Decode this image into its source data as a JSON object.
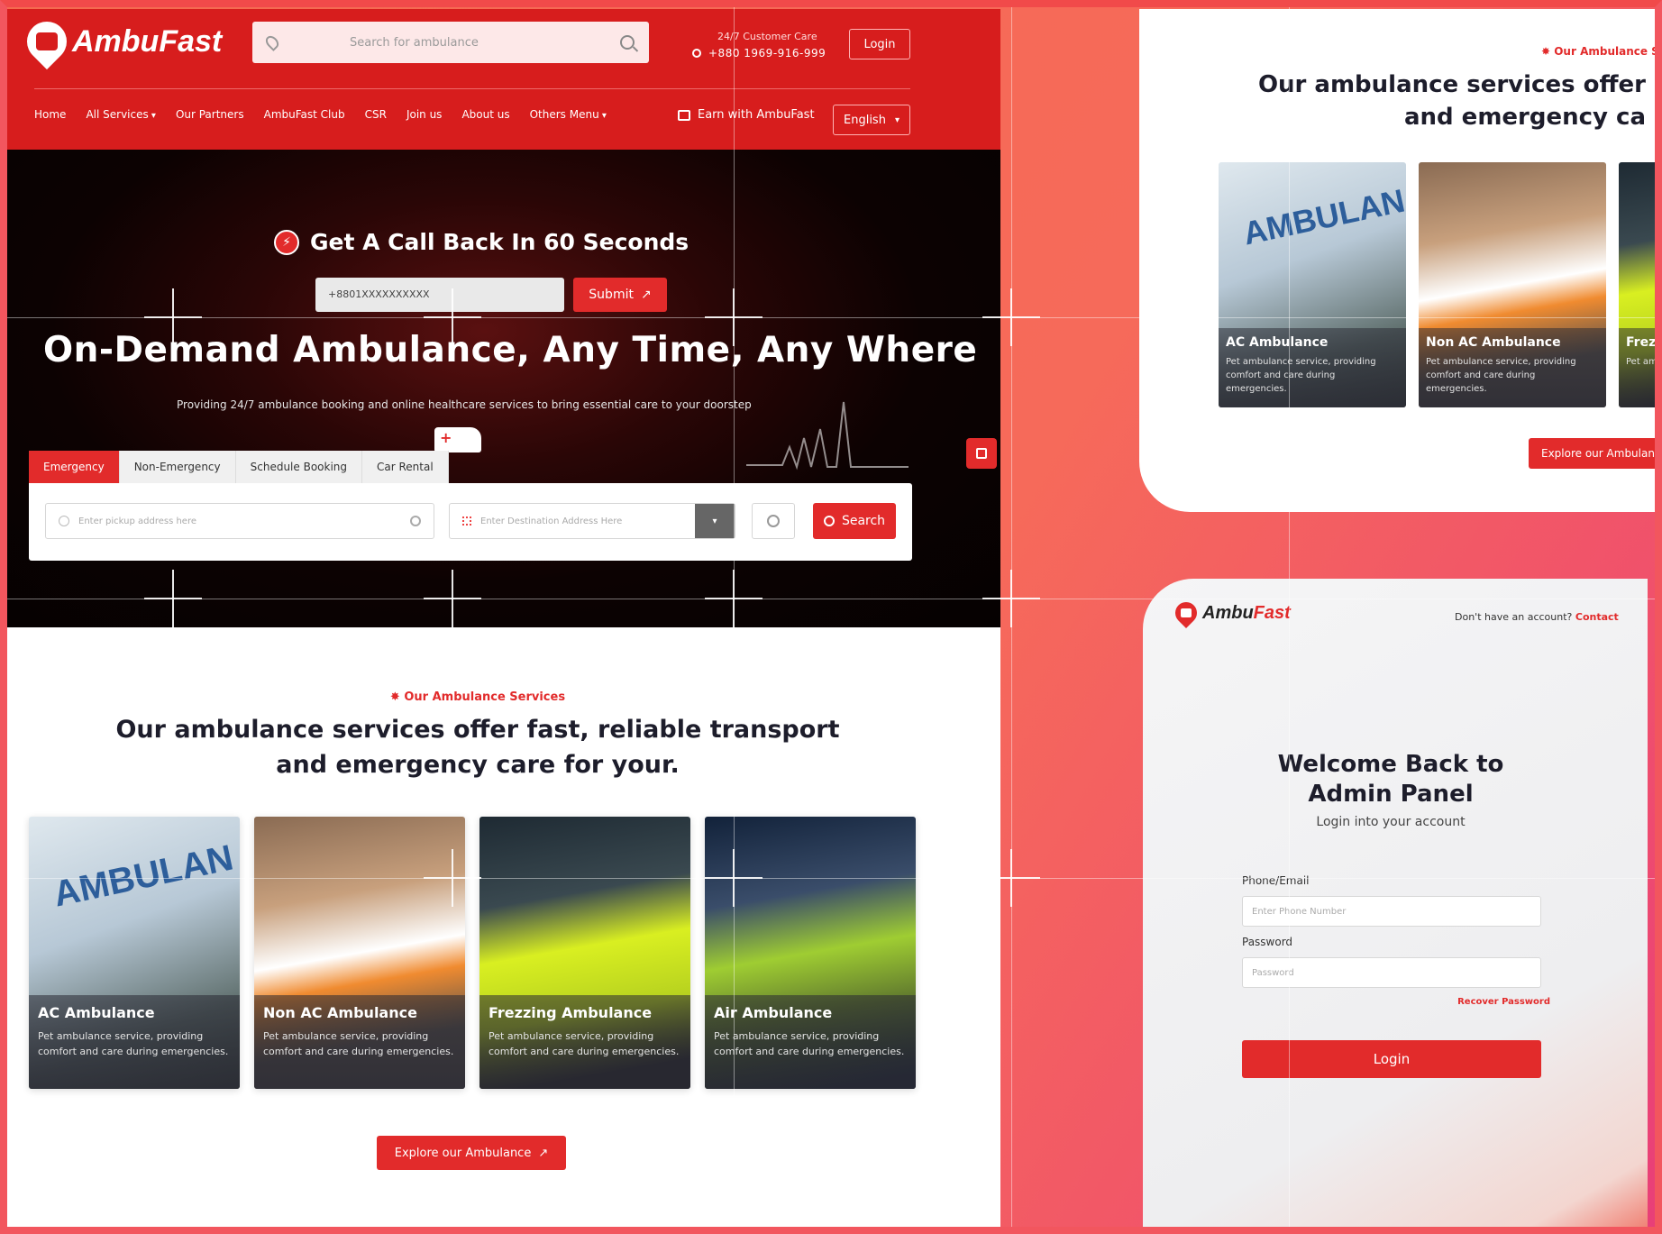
{
  "brand": {
    "name": "AmbuFast",
    "name_a": "Ambu",
    "name_b": "Fast"
  },
  "header": {
    "search_placeholder": "Search for ambulance",
    "care_label": "24/7 Customer Care",
    "care_phone": "+880 1969-916-999",
    "login_label": "Login",
    "nav": [
      "Home",
      "All Services",
      "Our Partners",
      "AmbuFast Club",
      "CSR",
      "Join us",
      "About us",
      "Others Menu"
    ],
    "earn_label": "Earn with AmbuFast",
    "language": "English"
  },
  "hero": {
    "callback_title": "Get A Call Back In 60 Seconds",
    "callback_input": "+8801XXXXXXXXXX",
    "submit_label": "Submit",
    "title": "On-Demand Ambulance, Any Time, Any Where",
    "subtitle": "Providing 24/7 ambulance booking and online healthcare services to bring essential care to your doorstep",
    "tabs": [
      "Emergency",
      "Non-Emergency",
      "Schedule Booking",
      "Car Rental"
    ],
    "pickup_placeholder": "Enter pickup address here",
    "destination_placeholder": "Enter Destination Address Here",
    "search_label": "Search"
  },
  "services": {
    "tag": "Our Ambulance Services",
    "heading_line1": "Our ambulance services offer fast, reliable transport",
    "heading_line2": "and emergency care for your.",
    "cards": [
      {
        "name": "AC Ambulance",
        "desc": "Pet ambulance service, providing comfort and care during emergencies.",
        "img_text": "AMBULAN"
      },
      {
        "name": "Non AC Ambulance",
        "desc": "Pet ambulance service, providing comfort and care during emergencies."
      },
      {
        "name": "Frezzing Ambulance",
        "desc": "Pet ambulance service, providing comfort and care during emergencies."
      },
      {
        "name": "Air Ambulance",
        "desc": "Pet ambulance service, providing comfort and care during emergencies."
      }
    ],
    "explore_label": "Explore our Ambulance"
  },
  "right_top": {
    "tag": "Our Ambulance Se",
    "heading_line1": "Our ambulance services offer",
    "heading_line2": "and emergency ca",
    "cards": [
      {
        "name": "AC Ambulance",
        "desc": "Pet ambulance service, providing comfort and care during emergencies.",
        "img_text": "AMBULAN"
      },
      {
        "name": "Non AC Ambulance",
        "desc": "Pet ambulance service, providing comfort and care during emergencies."
      },
      {
        "name": "Frez",
        "desc": "Pet am comf emerg"
      }
    ],
    "explore_label": "Explore our Ambulanc"
  },
  "login_panel": {
    "account_text": "Don't have an account?",
    "contact_label": "Contact",
    "title_line1": "Welcome Back to",
    "title_line2": "Admin Panel",
    "subtitle": "Login into your account",
    "phone_label": "Phone/Email",
    "phone_placeholder": "Enter Phone Number",
    "password_label": "Password",
    "password_placeholder": "Password",
    "recover_label": "Recover Password",
    "login_label": "Login"
  },
  "colors": {
    "brand_red": "#d71d1d",
    "accent_red": "#e22b2b",
    "background": "#f46b4f"
  }
}
